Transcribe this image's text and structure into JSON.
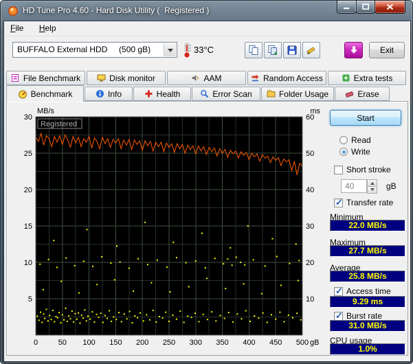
{
  "window": {
    "title": "HD Tune Pro 4.60 - Hard Disk Utility (  Registered )"
  },
  "menu": {
    "items": [
      "File",
      "Help"
    ]
  },
  "toolbar": {
    "drive": "BUFFALO External HDD     (500 gB)",
    "temperature": "33°C",
    "exit": "Exit"
  },
  "icons": {
    "titlebar": [
      "app-icon",
      "minimize-icon",
      "maximize-icon",
      "close-icon"
    ],
    "toolbar": [
      "thermometer-icon",
      "copy-icon",
      "copy-image-icon",
      "save-icon",
      "screenshot-icon",
      "download-icon"
    ],
    "tabs_row1": [
      "file-benchmark-icon",
      "disk-monitor-icon",
      "aam-icon",
      "random-access-icon",
      "extra-tests-icon"
    ],
    "tabs_row2": [
      "benchmark-icon",
      "info-icon",
      "health-icon",
      "error-scan-icon",
      "folder-usage-icon",
      "erase-icon"
    ]
  },
  "tabs": {
    "row1": [
      "File Benchmark",
      "Disk monitor",
      "AAM",
      "Random Access",
      "Extra tests"
    ],
    "row2": [
      "Benchmark",
      "Info",
      "Health",
      "Error Scan",
      "Folder Usage",
      "Erase"
    ]
  },
  "side": {
    "start": "Start",
    "read": "Read",
    "write": "Write",
    "short_stroke": "Short stroke",
    "stroke_value": "40",
    "stroke_unit": "gB",
    "transfer_rate": "Transfer rate",
    "minimum_label": "Minimum",
    "minimum_value": "22.0 MB/s",
    "maximum_label": "Maximum",
    "maximum_value": "27.7 MB/s",
    "average_label": "Average",
    "average_value": "25.8 MB/s",
    "access_label": "Access time",
    "access_value": "9.29 ms",
    "burst_label": "Burst rate",
    "burst_value": "31.0 MB/s",
    "cpu_label": "CPU usage",
    "cpu_value": "1.0%"
  },
  "chart_data": {
    "type": "line+scatter",
    "watermark": "Registered",
    "x_axis": {
      "min": 0,
      "max": 500,
      "ticks": [
        0,
        50,
        100,
        150,
        200,
        250,
        300,
        350,
        400,
        450,
        500
      ],
      "unit": "gB"
    },
    "left_axis": {
      "label": "MB/s",
      "min": 0,
      "max": 30,
      "ticks": [
        30,
        25,
        20,
        15,
        10,
        5
      ]
    },
    "right_axis": {
      "label": "ms",
      "min": 0,
      "max": 60,
      "ticks": [
        60,
        50,
        40,
        30,
        20,
        10
      ]
    },
    "series": [
      {
        "name": "transfer-rate",
        "type": "line",
        "axis": "left",
        "color": "#ff5a00",
        "x_step": 5,
        "values": [
          27.2,
          26.6,
          27.7,
          26.1,
          27.4,
          27.0,
          25.9,
          27.3,
          26.5,
          27.4,
          26.2,
          27.5,
          26.8,
          25.8,
          27.3,
          26.4,
          27.2,
          25.9,
          27.0,
          26.5,
          27.3,
          25.7,
          27.1,
          26.6,
          25.6,
          27.2,
          26.3,
          27.0,
          25.8,
          26.9,
          26.4,
          27.0,
          25.6,
          26.8,
          26.1,
          26.9,
          25.5,
          26.8,
          26.2,
          26.7,
          25.4,
          26.7,
          26.0,
          26.6,
          25.3,
          26.5,
          25.9,
          26.5,
          25.2,
          26.4,
          25.8,
          26.3,
          25.1,
          26.3,
          25.6,
          26.2,
          25.0,
          26.1,
          25.5,
          26.0,
          24.9,
          26.0,
          25.3,
          25.9,
          24.8,
          25.8,
          25.2,
          25.7,
          24.6,
          25.6,
          25.0,
          25.5,
          24.4,
          25.4,
          24.9,
          25.3,
          24.3,
          25.2,
          24.7,
          25.1,
          24.1,
          25.0,
          24.5,
          24.9,
          23.9,
          24.8,
          24.3,
          24.6,
          23.7,
          24.5,
          24.0,
          24.4,
          23.3,
          24.2,
          23.8,
          24.1,
          22.6,
          23.9,
          22.0,
          23.6,
          23.2
        ]
      },
      {
        "name": "access-time",
        "type": "scatter",
        "axis": "right",
        "color": "#ffff00",
        "points": [
          [
            3,
            5.2
          ],
          [
            6,
            4.1
          ],
          [
            9,
            6.3
          ],
          [
            12,
            3.5
          ],
          [
            15,
            5.8
          ],
          [
            17,
            4.6
          ],
          [
            20,
            7.1
          ],
          [
            23,
            3.9
          ],
          [
            26,
            5.4
          ],
          [
            29,
            4.3
          ],
          [
            32,
            6.8
          ],
          [
            35,
            3.7
          ],
          [
            38,
            5.1
          ],
          [
            41,
            4.8
          ],
          [
            44,
            6.2
          ],
          [
            47,
            3.4
          ],
          [
            50,
            5.6
          ],
          [
            53,
            4.2
          ],
          [
            56,
            7.4
          ],
          [
            59,
            3.8
          ],
          [
            62,
            5.3
          ],
          [
            65,
            4.5
          ],
          [
            68,
            6.6
          ],
          [
            71,
            3.6
          ],
          [
            74,
            5.9
          ],
          [
            77,
            4.4
          ],
          [
            80,
            6.1
          ],
          [
            83,
            3.3
          ],
          [
            86,
            5.5
          ],
          [
            89,
            4.7
          ],
          [
            92,
            6.9
          ],
          [
            95,
            3.9
          ],
          [
            98,
            5.2
          ],
          [
            102,
            4.4
          ],
          [
            106,
            6.4
          ],
          [
            110,
            3.6
          ],
          [
            114,
            5.7
          ],
          [
            118,
            4.9
          ],
          [
            122,
            6.0
          ],
          [
            126,
            3.5
          ],
          [
            130,
            5.4
          ],
          [
            134,
            4.6
          ],
          [
            138,
            6.7
          ],
          [
            142,
            3.8
          ],
          [
            146,
            5.0
          ],
          [
            151,
            4.3
          ],
          [
            156,
            6.2
          ],
          [
            161,
            3.7
          ],
          [
            166,
            5.8
          ],
          [
            171,
            4.5
          ],
          [
            176,
            6.5
          ],
          [
            181,
            3.4
          ],
          [
            186,
            5.3
          ],
          [
            191,
            4.8
          ],
          [
            196,
            6.1
          ],
          [
            202,
            3.9
          ],
          [
            208,
            5.6
          ],
          [
            214,
            4.2
          ],
          [
            220,
            6.8
          ],
          [
            226,
            3.6
          ],
          [
            232,
            5.1
          ],
          [
            238,
            4.7
          ],
          [
            244,
            6.3
          ],
          [
            250,
            3.8
          ],
          [
            257,
            5.5
          ],
          [
            264,
            4.4
          ],
          [
            271,
            6.6
          ],
          [
            278,
            3.5
          ],
          [
            285,
            5.2
          ],
          [
            292,
            4.9
          ],
          [
            299,
            6.0
          ],
          [
            306,
            3.7
          ],
          [
            314,
            5.7
          ],
          [
            322,
            4.3
          ],
          [
            330,
            6.4
          ],
          [
            338,
            3.9
          ],
          [
            346,
            5.4
          ],
          [
            354,
            4.6
          ],
          [
            362,
            6.2
          ],
          [
            370,
            3.6
          ],
          [
            378,
            5.8
          ],
          [
            386,
            4.5
          ],
          [
            394,
            6.7
          ],
          [
            402,
            3.8
          ],
          [
            410,
            5.3
          ],
          [
            418,
            4.7
          ],
          [
            426,
            6.1
          ],
          [
            434,
            3.5
          ],
          [
            442,
            5.6
          ],
          [
            450,
            4.4
          ],
          [
            458,
            6.3
          ],
          [
            466,
            3.7
          ],
          [
            474,
            5.5
          ],
          [
            482,
            4.8
          ],
          [
            490,
            6.0
          ],
          [
            497,
            4.2
          ],
          [
            14,
            12.5
          ],
          [
            48,
            14.8
          ],
          [
            81,
            11.6
          ],
          [
            115,
            13.9
          ],
          [
            148,
            15.2
          ],
          [
            183,
            12.1
          ],
          [
            217,
            14.4
          ],
          [
            252,
            11.9
          ],
          [
            287,
            13.3
          ],
          [
            321,
            15.6
          ],
          [
            356,
            12.8
          ],
          [
            390,
            14.1
          ],
          [
            424,
            11.4
          ],
          [
            460,
            13.7
          ],
          [
            492,
            15.0
          ],
          [
            8,
            19.5
          ],
          [
            24,
            20.8
          ],
          [
            40,
            18.6
          ],
          [
            57,
            21.2
          ],
          [
            73,
            19.1
          ],
          [
            90,
            20.3
          ],
          [
            107,
            18.9
          ],
          [
            124,
            21.5
          ],
          [
            141,
            19.8
          ],
          [
            158,
            20.1
          ],
          [
            175,
            18.4
          ],
          [
            192,
            21.0
          ],
          [
            210,
            19.4
          ],
          [
            228,
            20.6
          ],
          [
            246,
            18.7
          ],
          [
            264,
            21.3
          ],
          [
            282,
            19.9
          ],
          [
            300,
            20.4
          ],
          [
            318,
            18.5
          ],
          [
            336,
            21.1
          ],
          [
            352,
            19.6
          ],
          [
            360,
            20.9
          ],
          [
            368,
            19.2
          ],
          [
            376,
            21.4
          ],
          [
            384,
            20.0
          ],
          [
            392,
            19.3
          ],
          [
            408,
            20.7
          ],
          [
            430,
            19.0
          ],
          [
            452,
            21.6
          ],
          [
            476,
            19.7
          ],
          [
            494,
            20.5
          ],
          [
            34,
            26
          ],
          [
            96,
            29
          ],
          [
            152,
            24.5
          ],
          [
            205,
            31
          ],
          [
            258,
            25.5
          ],
          [
            312,
            28
          ],
          [
            365,
            24
          ],
          [
            398,
            30
          ],
          [
            444,
            26.5
          ],
          [
            488,
            25
          ]
        ]
      }
    ]
  }
}
